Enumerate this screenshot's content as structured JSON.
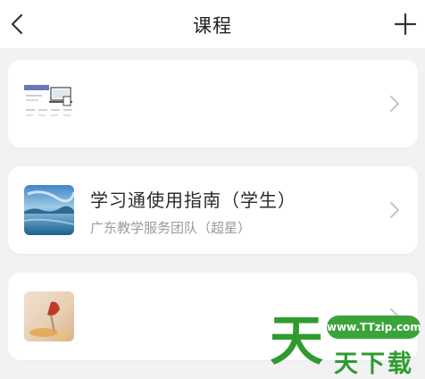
{
  "header": {
    "title": "课程"
  },
  "courses": [
    {
      "title": "",
      "subtitle": ""
    },
    {
      "title": "学习通使用指南（学生）",
      "subtitle": "广东教学服务团队（超星）"
    },
    {
      "title": "",
      "subtitle": ""
    }
  ],
  "watermark": {
    "url": "www.TTzip.com",
    "big": "天",
    "small": "天下载"
  }
}
